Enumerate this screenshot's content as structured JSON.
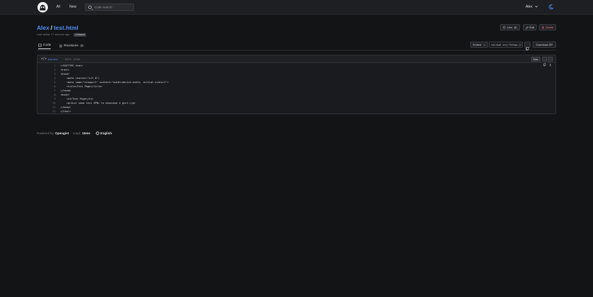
{
  "nav": {
    "all": "All",
    "new": "New",
    "search_placeholder": "Code search",
    "user": "Alex"
  },
  "gist": {
    "owner": "Alex",
    "name": "test.html",
    "subtitle": "Last active 17 minutes ago",
    "visibility": "Unlisted",
    "like_label": "Like",
    "like_count": "0",
    "edit_label": "Edit",
    "delete_label": "Delete"
  },
  "tabs": {
    "code": "Code",
    "revisions": "Revisions",
    "revisions_count": "2"
  },
  "embed": {
    "select_label": "Embed",
    "snippet": "<script src=\"https://",
    "download_label": "Download ZIP"
  },
  "file": {
    "name": "test.html",
    "meta": " · 292 B · HTML",
    "raw_label": "Raw",
    "lines": [
      {
        "n": "1",
        "t": "<!DOCTYPE html>"
      },
      {
        "n": "2",
        "t": "<html>"
      },
      {
        "n": "3",
        "t": "<head>"
      },
      {
        "n": "4",
        "t": "    <meta charset=\"utf-8\">"
      },
      {
        "n": "5",
        "t": "    <meta name=\"viewport\" content=\"width=device-width, initial-scale=1\">"
      },
      {
        "n": "6",
        "t": "    <title>Test Page</title>"
      },
      {
        "n": "7",
        "t": "</head>"
      },
      {
        "n": "8",
        "t": "<body>"
      },
      {
        "n": "9",
        "t": "    <h1>Test Page</h1>"
      },
      {
        "n": "10",
        "t": "    <p>Just some test HTML to showcase a gist.</p>"
      },
      {
        "n": "11",
        "t": "</body>"
      },
      {
        "n": "12",
        "t": "</html>"
      }
    ]
  },
  "footer": {
    "powered_by": "Powered by",
    "brand": "Opengist",
    "load_label": "Load:",
    "load_value": "15ms",
    "language": "English"
  },
  "colors": {
    "background": "#131416",
    "accent": "#4f8ff7",
    "danger": "#f57070"
  }
}
